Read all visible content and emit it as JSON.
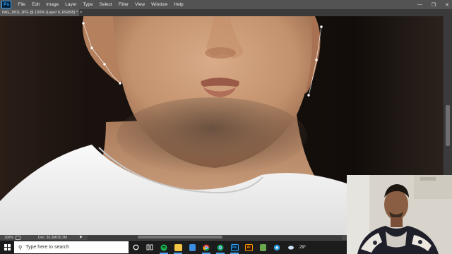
{
  "app": {
    "logo": "Ps"
  },
  "menu": [
    "File",
    "Edit",
    "Image",
    "Layer",
    "Type",
    "Select",
    "Filter",
    "View",
    "Window",
    "Help"
  ],
  "window_controls": {
    "minimize": "—",
    "restore": "❐",
    "close": "✕"
  },
  "document_tab": {
    "title": "IMG_5811.JPG @ 100% (Layer 0, RGB/8) *",
    "close": "×"
  },
  "status": {
    "zoom": "100%",
    "doc_size": "Doc: 30,3M/30,3M",
    "arrow": "▶"
  },
  "taskbar": {
    "search_placeholder": "Type here to search",
    "search_icon": "magnifier-icon",
    "icons": [
      "cortana-icon",
      "task-view-icon",
      "spotify-icon",
      "file-explorer-icon",
      "files-icon",
      "chrome-icon",
      "chrome-alt-icon",
      "photoshop-icon",
      "illustrator-icon",
      "app-icon",
      "settings-icon",
      "weather-icon"
    ],
    "photoshop_label": "Ps",
    "illustrator_label": "Ai",
    "temperature": "29°"
  },
  "colors": {
    "menubar": "#535353",
    "skin": "#c89a78",
    "shirt": "#f2f2f2",
    "background": "#1b1410",
    "accent_blue": "#31a8ff"
  }
}
